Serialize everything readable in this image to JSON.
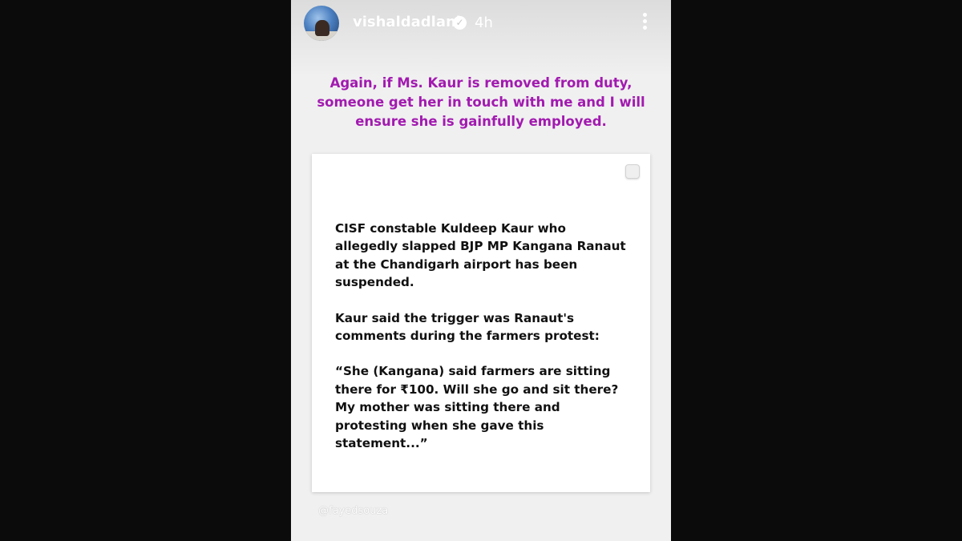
{
  "header": {
    "username": "vishaldadlani",
    "verified_mark": "✓",
    "timestamp": "4h",
    "avatar_icon": "profile-photo",
    "more_icon": "more-vertical-icon"
  },
  "caption": {
    "line1": "Again, if Ms. Kaur is removed from duty,",
    "line2": "someone get her in touch with me and I will",
    "line3": "ensure she is gainfully employed.",
    "color": "#a21ab0"
  },
  "card": {
    "paragraph1": "CISF constable Kuldeep Kaur who allegedly slapped BJP MP Kangana Ranaut at the Chandigarh airport has been suspended.",
    "paragraph2": "Kaur said the trigger was Ranaut's comments during the farmers protest:",
    "paragraph3": "“She (Kangana) said farmers are sitting there for ₹100. Will she go and sit there? My mother was sitting there and protesting when she gave this statement...”"
  },
  "mention": "@fayedsouza"
}
